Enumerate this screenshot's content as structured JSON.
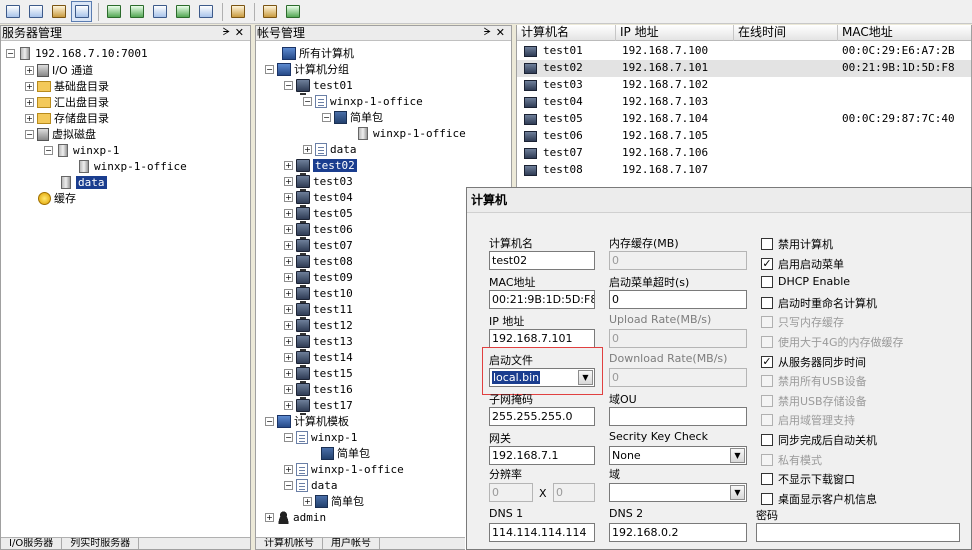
{
  "server_pane": {
    "title": "服务器管理",
    "root": "192.168.7.10:7001",
    "items": [
      "I/O 通道",
      "基础盘目录",
      "汇出盘目录",
      "存储盘目录",
      "虚拟磁盘"
    ],
    "vdisk_children": {
      "winxp": "winxp-1",
      "office": "winxp-1-office",
      "data": "data"
    },
    "cache": "缓存",
    "tabs": [
      "I/O服务器",
      "列实时服务器"
    ]
  },
  "account_pane": {
    "title": "帐号管理",
    "all_computers": "所有计算机",
    "group_label": "计算机分组",
    "test01": "test01",
    "test01_children": {
      "office": "winxp-1-office",
      "pkg": "简单包",
      "office2": "winxp-1-office",
      "data": "data"
    },
    "tests": [
      "test02",
      "test03",
      "test04",
      "test05",
      "test06",
      "test07",
      "test08",
      "test09",
      "test10",
      "test11",
      "test12",
      "test13",
      "test14",
      "test15",
      "test16",
      "test17"
    ],
    "template_label": "计算机模板",
    "templates": {
      "winxp": "winxp-1",
      "pkg1": "简单包",
      "office": "winxp-1-office",
      "data": "data",
      "pkg2": "简单包"
    },
    "admin": "admin",
    "tabs": [
      "计算机帐号",
      "用户帐号"
    ]
  },
  "list": {
    "headers": [
      "计算机名",
      "IP 地址",
      "在线时间",
      "MAC地址"
    ],
    "rows": [
      {
        "name": "test01",
        "ip": "192.168.7.100",
        "mac": "00:0C:29:E6:A7:2B"
      },
      {
        "name": "test02",
        "ip": "192.168.7.101",
        "mac": "00:21:9B:1D:5D:F8"
      },
      {
        "name": "test03",
        "ip": "192.168.7.102",
        "mac": ""
      },
      {
        "name": "test04",
        "ip": "192.168.7.103",
        "mac": ""
      },
      {
        "name": "test05",
        "ip": "192.168.7.104",
        "mac": "00:0C:29:87:7C:40"
      },
      {
        "name": "test06",
        "ip": "192.168.7.105",
        "mac": ""
      },
      {
        "name": "test07",
        "ip": "192.168.7.106",
        "mac": ""
      },
      {
        "name": "test08",
        "ip": "192.168.7.107",
        "mac": ""
      }
    ]
  },
  "dialog": {
    "title": "计算机",
    "labels": {
      "name": "计算机名",
      "mac": "MAC地址",
      "ip": "IP 地址",
      "boot": "启动文件",
      "mask": "子网掩码",
      "gw": "网关",
      "res": "分辨率",
      "dns1": "DNS 1",
      "mem": "内存缓存(MB)",
      "menu_timeout": "启动菜单超时(s)",
      "upload": "Upload Rate(MB/s)",
      "download": "Download Rate(MB/s)",
      "domain_ou": "域OU",
      "key": "Secrity Key Check",
      "domain": "域",
      "dns2": "DNS 2",
      "pwd": "密码",
      "x": "X"
    },
    "values": {
      "name": "test02",
      "mac": "00:21:9B:1D:5D:F8",
      "ip": "192.168.7.101",
      "boot": "local.bin",
      "mask": "255.255.255.0",
      "gw": "192.168.7.1",
      "res_w": "0",
      "res_h": "0",
      "dns1": "114.114.114.114",
      "mem": "0",
      "menu_timeout": "0",
      "upload": "0",
      "download": "0",
      "domain_ou": "",
      "key": "None",
      "domain": "",
      "dns2": "192.168.0.2",
      "pwd": ""
    },
    "checks": [
      {
        "label": "禁用计算机",
        "checked": false,
        "disabled": false
      },
      {
        "label": "启用启动菜单",
        "checked": true,
        "disabled": false
      },
      {
        "label": "DHCP Enable",
        "checked": false,
        "disabled": false
      },
      {
        "label": "启动时重命名计算机",
        "checked": false,
        "disabled": false
      },
      {
        "label": "只写内存缓存",
        "checked": false,
        "disabled": true
      },
      {
        "label": "使用大于4G的内存做缓存",
        "checked": false,
        "disabled": true
      },
      {
        "label": "从服务器同步时间",
        "checked": true,
        "disabled": false
      },
      {
        "label": "禁用所有USB设备",
        "checked": false,
        "disabled": true
      },
      {
        "label": "禁用USB存储设备",
        "checked": false,
        "disabled": true
      },
      {
        "label": "启用域管理支持",
        "checked": false,
        "disabled": true
      },
      {
        "label": "同步完成后自动关机",
        "checked": false,
        "disabled": false
      },
      {
        "label": "私有模式",
        "checked": false,
        "disabled": true
      },
      {
        "label": "不显示下载窗口",
        "checked": false,
        "disabled": false
      },
      {
        "label": "桌面显示客户机信息",
        "checked": false,
        "disabled": false
      }
    ]
  }
}
